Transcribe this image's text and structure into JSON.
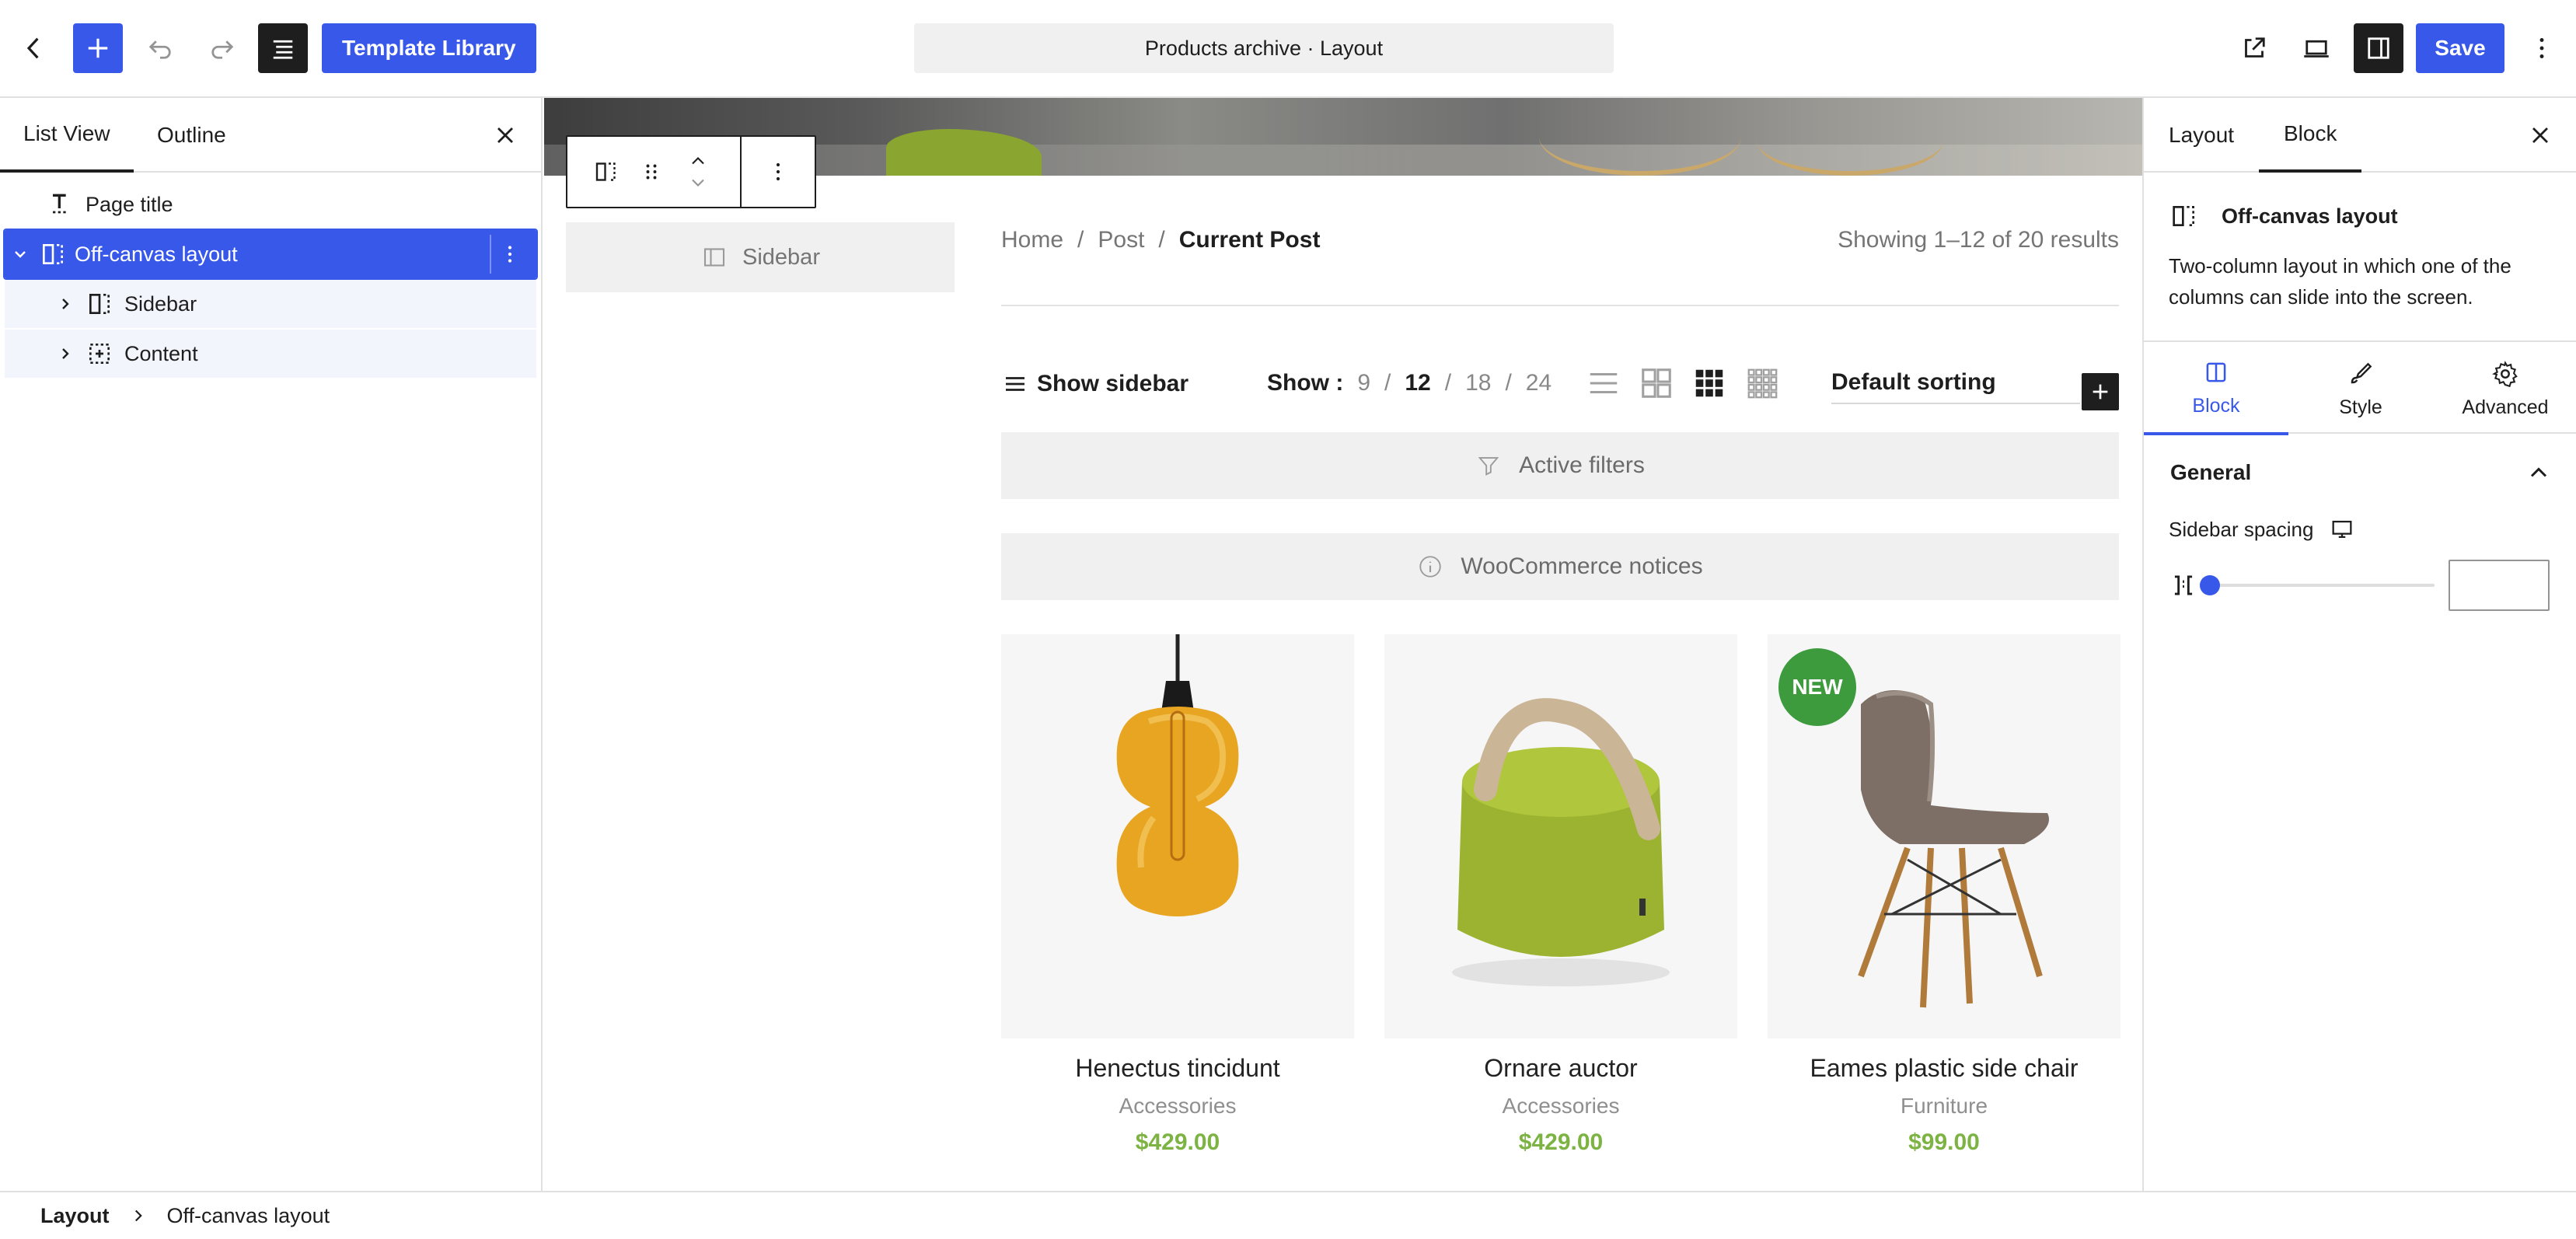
{
  "topbar": {
    "template_library": "Template Library",
    "document_title": "Products archive · Layout",
    "save": "Save"
  },
  "left_panel": {
    "tabs": [
      "List View",
      "Outline"
    ],
    "tree": [
      {
        "label": "Page title",
        "icon": "page-title-icon"
      },
      {
        "label": "Off-canvas layout",
        "icon": "off-canvas-icon",
        "selected": true,
        "expanded": true
      },
      {
        "label": "Sidebar",
        "icon": "sidebar-column-icon"
      },
      {
        "label": "Content",
        "icon": "content-column-icon"
      }
    ]
  },
  "canvas": {
    "sidebar_label": "Sidebar",
    "breadcrumbs": [
      "Home",
      "Post",
      "Current Post"
    ],
    "results": "Showing 1–12 of 20 results",
    "show_sidebar": "Show sidebar",
    "per_page": {
      "label": "Show :",
      "options": [
        "9",
        "12",
        "18",
        "24"
      ],
      "selected": "12"
    },
    "sorting": "Default sorting",
    "active_filters": "Active filters",
    "woo_notices": "WooCommerce notices",
    "products": [
      {
        "name": "Henectus tincidunt",
        "category": "Accessories",
        "price": "$429.00"
      },
      {
        "name": "Ornare auctor",
        "category": "Accessories",
        "price": "$429.00"
      },
      {
        "name": "Eames plastic side chair",
        "category": "Furniture",
        "price": "$99.00",
        "badge": "NEW"
      }
    ]
  },
  "right_panel": {
    "tabs": [
      "Layout",
      "Block"
    ],
    "block_title": "Off-canvas layout",
    "block_description": "Two-column layout in which one of the columns can slide into the screen.",
    "inspector_tabs": [
      "Block",
      "Style",
      "Advanced"
    ],
    "general": "General",
    "sidebar_spacing": "Sidebar spacing",
    "spacing_value": ""
  },
  "footer": {
    "crumbs": [
      "Layout",
      "Off-canvas layout"
    ]
  },
  "colors": {
    "accent": "#3858e9",
    "price": "#7cb342",
    "badge": "#3d9a3d"
  }
}
